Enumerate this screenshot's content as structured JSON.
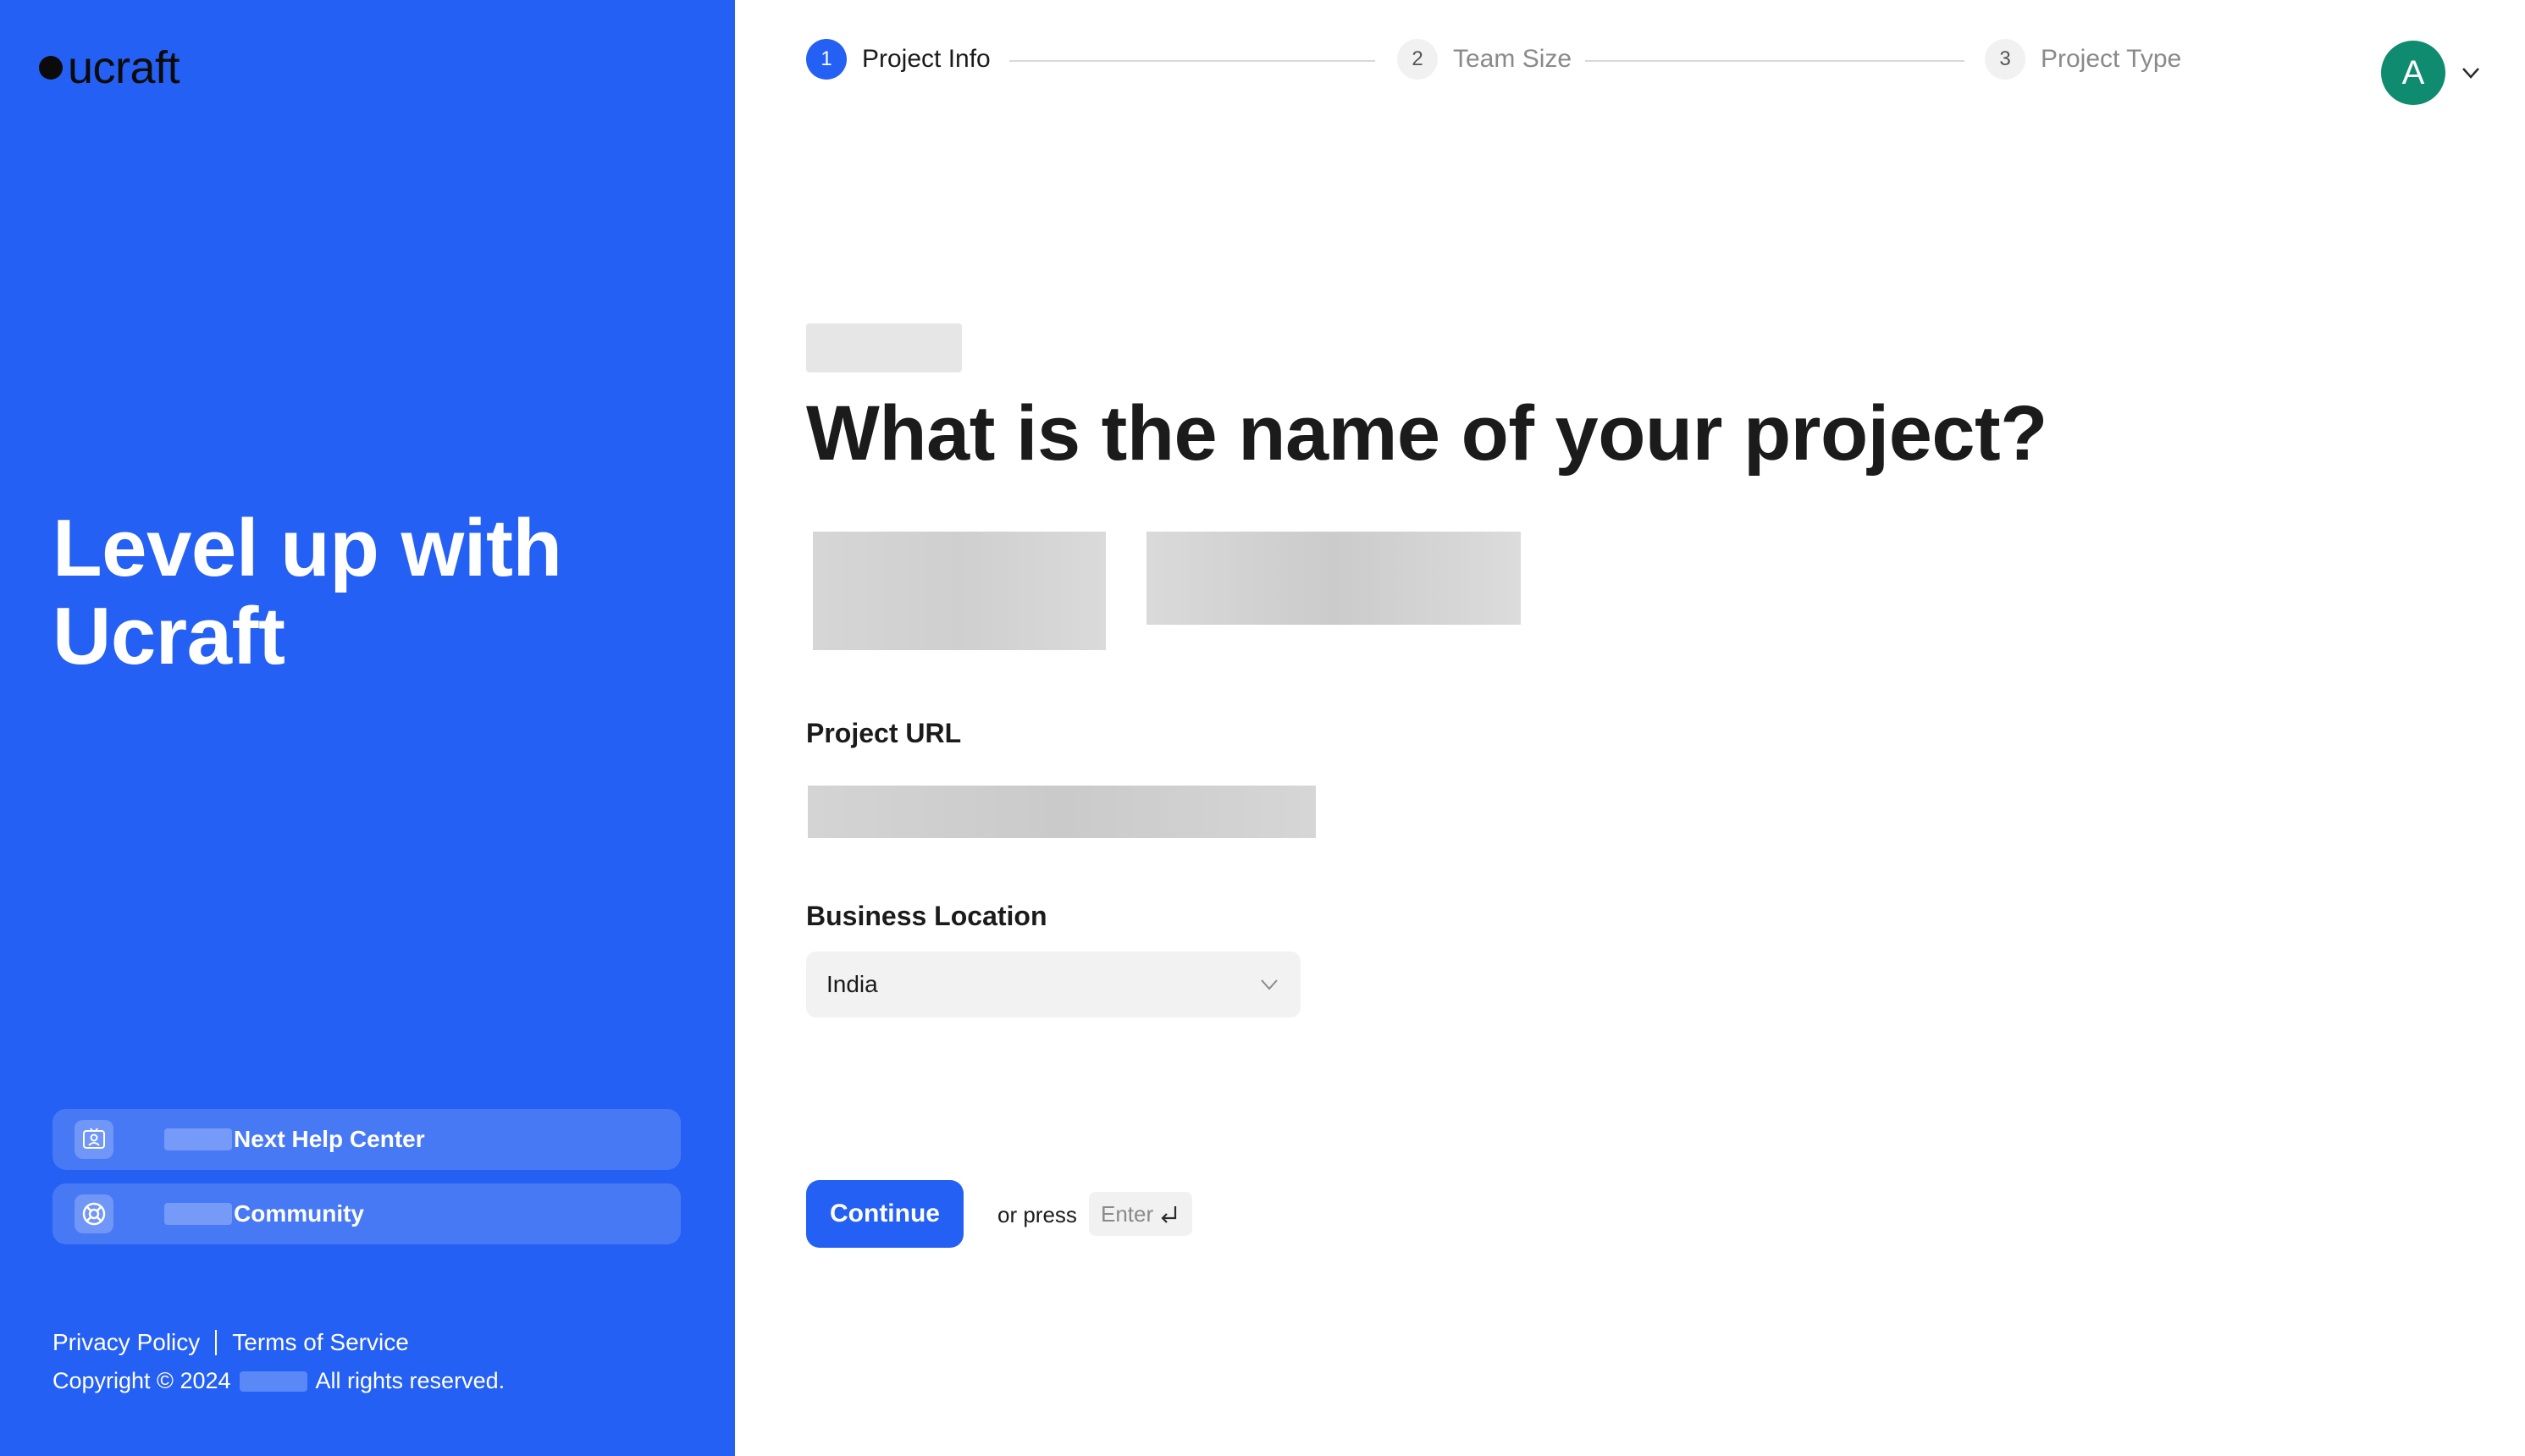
{
  "brand": {
    "logo_text": "ucraft"
  },
  "left_panel": {
    "hero_title": "Level up with Ucraft",
    "help_links": [
      {
        "label": "Next Help Center",
        "icon": "help-center-icon"
      },
      {
        "label": "Community",
        "icon": "lifebuoy-icon"
      }
    ],
    "footer": {
      "privacy": "Privacy Policy",
      "terms": "Terms of Service",
      "copyright_prefix": "Copyright © 2024",
      "copyright_suffix": "All rights reserved."
    }
  },
  "stepper": {
    "steps": [
      {
        "number": "1",
        "label": "Project Info",
        "state": "active"
      },
      {
        "number": "2",
        "label": "Team Size",
        "state": "inactive"
      },
      {
        "number": "3",
        "label": "Project Type",
        "state": "inactive"
      }
    ]
  },
  "user": {
    "avatar_letter": "A",
    "avatar_color": "#0f8b6f"
  },
  "form": {
    "question": "What is the name of your project?",
    "url_label": "Project URL",
    "location_label": "Business Location",
    "location_value": "India",
    "continue_label": "Continue",
    "or_press": "or press",
    "enter_key": "Enter"
  },
  "colors": {
    "brand_blue": "#2560f4",
    "field_bg": "#f2f2f2"
  }
}
